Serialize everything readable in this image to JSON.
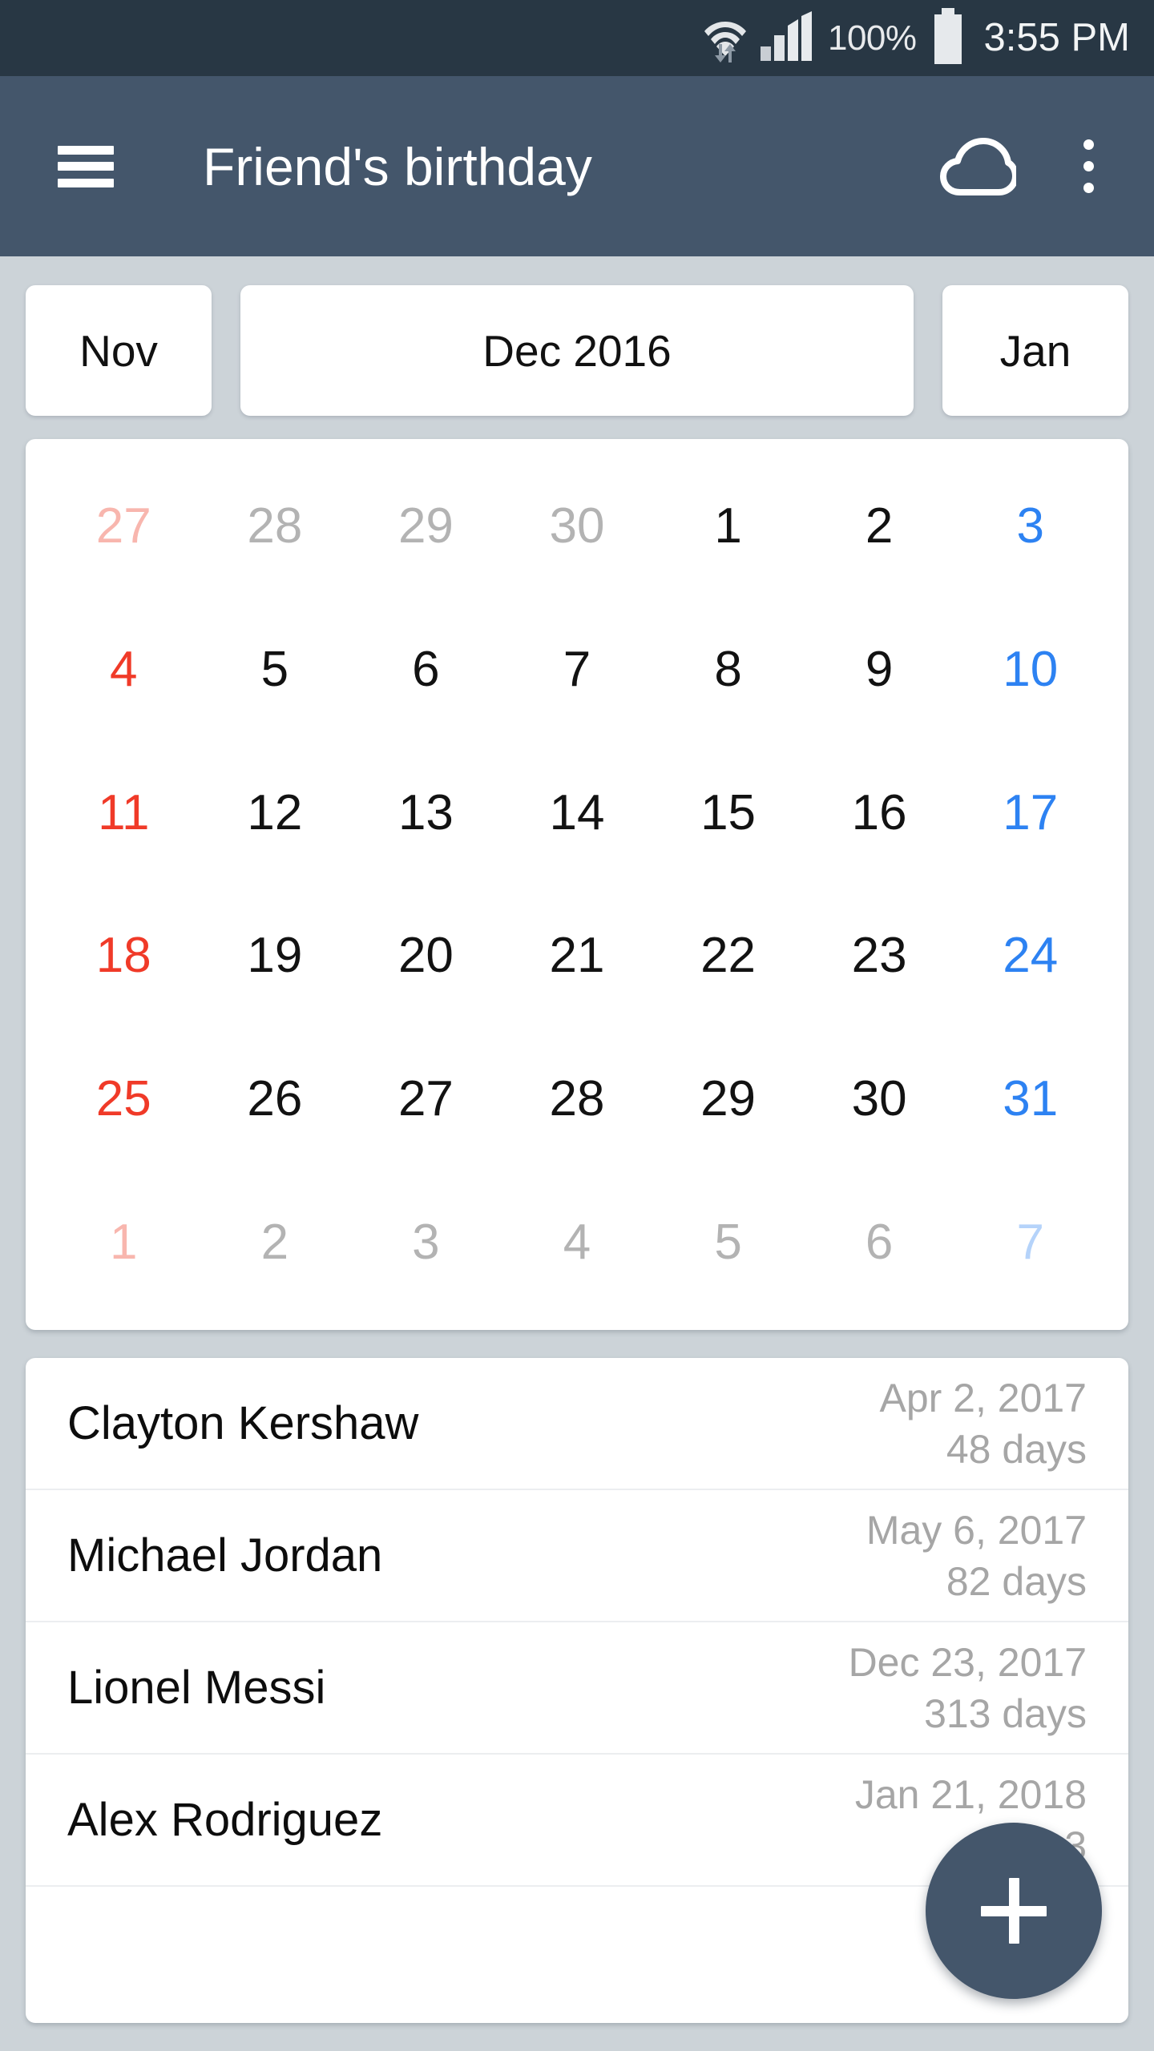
{
  "status_bar": {
    "wifi_icon": "wifi-icon",
    "data_transfer_icon": "data-transfer-arrows-icon",
    "signal_icon": "cellular-signal-icon",
    "battery_percent": "100%",
    "battery_icon": "battery-full-icon",
    "time": "3:55 PM"
  },
  "app_bar": {
    "menu_icon": "hamburger-menu-icon",
    "title": "Friend's birthday",
    "cloud_icon": "cloud-icon",
    "overflow_icon": "overflow-menu-icon",
    "background_color": "#44566b"
  },
  "month_switcher": {
    "prev_label": "Nov",
    "current_label": "Dec 2016",
    "next_label": "Jan"
  },
  "calendar": {
    "colors": {
      "weekday": "#121212",
      "sunday": "#f03a28",
      "saturday": "#2d82f2",
      "out_weekday": "#b3b3b3",
      "out_sunday": "#f8b6ae",
      "out_saturday": "#b5d3fa"
    },
    "rows": [
      [
        {
          "day": "27",
          "kind": "out-sunday"
        },
        {
          "day": "28",
          "kind": "out-weekday"
        },
        {
          "day": "29",
          "kind": "out-weekday"
        },
        {
          "day": "30",
          "kind": "out-weekday"
        },
        {
          "day": "1",
          "kind": "weekday"
        },
        {
          "day": "2",
          "kind": "weekday"
        },
        {
          "day": "3",
          "kind": "saturday"
        }
      ],
      [
        {
          "day": "4",
          "kind": "sunday"
        },
        {
          "day": "5",
          "kind": "weekday"
        },
        {
          "day": "6",
          "kind": "weekday"
        },
        {
          "day": "7",
          "kind": "weekday"
        },
        {
          "day": "8",
          "kind": "weekday"
        },
        {
          "day": "9",
          "kind": "weekday"
        },
        {
          "day": "10",
          "kind": "saturday"
        }
      ],
      [
        {
          "day": "11",
          "kind": "sunday"
        },
        {
          "day": "12",
          "kind": "weekday"
        },
        {
          "day": "13",
          "kind": "weekday"
        },
        {
          "day": "14",
          "kind": "weekday"
        },
        {
          "day": "15",
          "kind": "weekday"
        },
        {
          "day": "16",
          "kind": "weekday"
        },
        {
          "day": "17",
          "kind": "saturday"
        }
      ],
      [
        {
          "day": "18",
          "kind": "sunday"
        },
        {
          "day": "19",
          "kind": "weekday"
        },
        {
          "day": "20",
          "kind": "weekday"
        },
        {
          "day": "21",
          "kind": "weekday"
        },
        {
          "day": "22",
          "kind": "weekday"
        },
        {
          "day": "23",
          "kind": "weekday"
        },
        {
          "day": "24",
          "kind": "saturday"
        }
      ],
      [
        {
          "day": "25",
          "kind": "sunday"
        },
        {
          "day": "26",
          "kind": "weekday"
        },
        {
          "day": "27",
          "kind": "weekday"
        },
        {
          "day": "28",
          "kind": "weekday"
        },
        {
          "day": "29",
          "kind": "weekday"
        },
        {
          "day": "30",
          "kind": "weekday"
        },
        {
          "day": "31",
          "kind": "saturday"
        }
      ],
      [
        {
          "day": "1",
          "kind": "out-sunday"
        },
        {
          "day": "2",
          "kind": "out-weekday"
        },
        {
          "day": "3",
          "kind": "out-weekday"
        },
        {
          "day": "4",
          "kind": "out-weekday"
        },
        {
          "day": "5",
          "kind": "out-weekday"
        },
        {
          "day": "6",
          "kind": "out-weekday"
        },
        {
          "day": "7",
          "kind": "out-saturday"
        }
      ]
    ]
  },
  "event_list": {
    "rows": [
      {
        "name": "Clayton Kershaw",
        "date": "Apr 2, 2017",
        "days": "48 days"
      },
      {
        "name": "Michael Jordan",
        "date": "May 6, 2017",
        "days": "82 days"
      },
      {
        "name": "Lionel Messi",
        "date": "Dec 23, 2017",
        "days": "313 days"
      },
      {
        "name": "Alex Rodriguez",
        "date": "Jan 21, 2018",
        "days": "3"
      }
    ]
  },
  "fab": {
    "icon": "plus-icon",
    "color": "#44566b"
  }
}
